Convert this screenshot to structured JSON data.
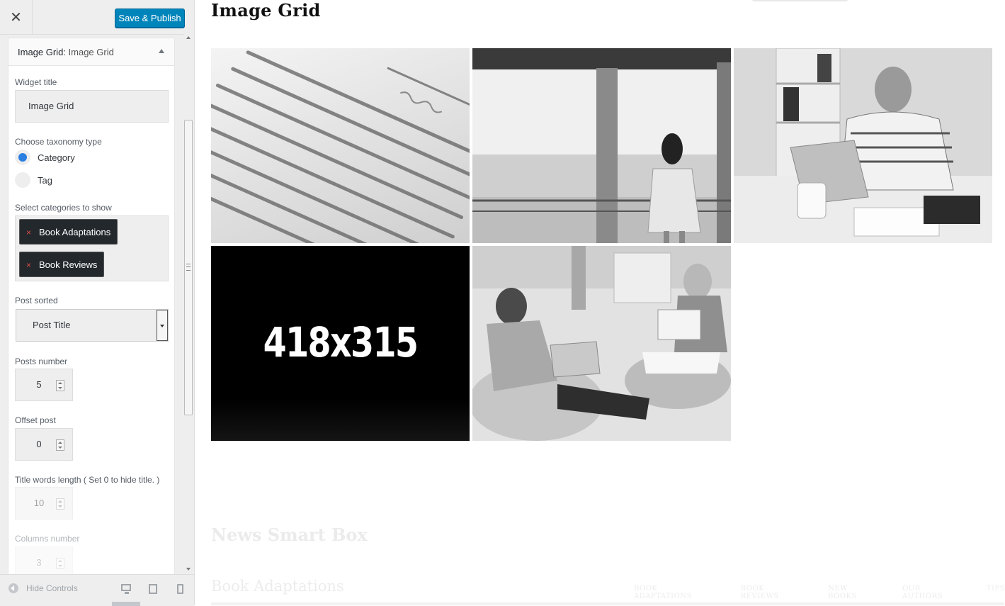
{
  "header": {
    "close_icon": "close-icon",
    "publish_label": "Save & Publish",
    "accent_color": "#0085ba"
  },
  "widget": {
    "title_main": "Image Grid:",
    "title_sub": " Image Grid",
    "widget_title_label": "Widget title",
    "widget_title_value": "Image Grid",
    "taxonomy_label": "Choose taxonomy type",
    "taxonomy_options": [
      {
        "label": "Category",
        "checked": true
      },
      {
        "label": "Tag",
        "checked": false
      }
    ],
    "categories_label": "Select categories to show",
    "categories": [
      {
        "remove": "×",
        "label": "Book Adaptations"
      },
      {
        "remove": "×",
        "label": "Book Reviews"
      }
    ],
    "sorted_label": "Post sorted",
    "sorted_value": "Post Title",
    "posts_number_label": "Posts number",
    "posts_number_value": "5",
    "offset_label": "Offset post",
    "offset_value": "0",
    "title_words_label": "Title words length ( Set 0 to hide title. )",
    "title_words_value": "10",
    "columns_label": "Columns number",
    "columns_value": "3"
  },
  "footer": {
    "hide_controls": "Hide Controls",
    "devices": [
      "desktop-icon",
      "tablet-icon",
      "mobile-icon"
    ]
  },
  "preview": {
    "section_title": "Image Grid",
    "placeholder_text": "418x315",
    "next_section_title": "News Smart Box",
    "next_subtitle": "Book Adaptations",
    "tabs": [
      "BOOK ADAPTATIONS",
      "BOOK REVIEWS",
      "NEW BOOKS",
      "OUR AUTHORS",
      "TIPS"
    ]
  }
}
